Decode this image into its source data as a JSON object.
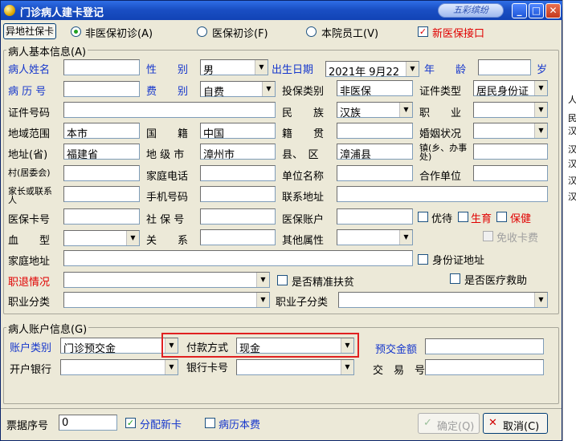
{
  "window": {
    "title": "门诊病人建卡登记",
    "badge": "五彩缤纷"
  },
  "right_strip": [
    "人",
    "民",
    "汉",
    "汉",
    "汉",
    "汉",
    "汉"
  ],
  "top": {
    "remote_card_button": "异地社保卡",
    "radio_non_insured": "非医保初诊(A)",
    "radio_insured": "医保初诊(F)",
    "radio_staff": "本院员工(V)",
    "new_insurance_interface": "新医保接口"
  },
  "basic": {
    "group_title": "病人基本信息(A)",
    "name_label": "病人姓名",
    "name_value": "",
    "gender_label": "性　　别",
    "gender_value": "男",
    "birth_label": "出生日期",
    "birth_value": "2021年 9月22",
    "age_label": "年　　龄",
    "age_value": "",
    "age_unit": "岁",
    "record_label": "病 历 号",
    "record_value": "",
    "fee_label": "费　　别",
    "fee_value": "自费",
    "insure_type_label": "投保类别",
    "insure_type_value": "非医保",
    "id_type_label": "证件类型",
    "id_type_value": "居民身份证",
    "id_no_label": "证件号码",
    "id_no_value": "",
    "nation_label": "民　　族",
    "nation_value": "汉族",
    "job_label": "职　　业",
    "job_value": "",
    "region_label": "地域范围",
    "region_value": "本市",
    "country_label": "国　　籍",
    "country_value": "中国",
    "native_label": "籍　　贯",
    "native_value": "",
    "marital_label": "婚姻状况",
    "marital_value": "",
    "province_label": "地址(省)",
    "province_value": "福建省",
    "city_label": "地 级 市",
    "city_value": "漳州市",
    "county_label": "县、　区",
    "county_value": "漳浦县",
    "town_label": "镇(乡、办事处)",
    "town_value": "",
    "village_label": "村(居委会)",
    "village_value": "",
    "home_phone_label": "家庭电话",
    "home_phone_value": "",
    "work_unit_label": "单位名称",
    "work_unit_value": "",
    "coop_unit_label": "合作单位",
    "coop_unit_value": "",
    "guardian_label": "家长或联系人",
    "guardian_value": "",
    "mobile_label": "手机号码",
    "mobile_value": "",
    "contact_addr_label": "联系地址",
    "contact_addr_value": "",
    "insurance_card_label": "医保卡号",
    "insurance_card_value": "",
    "social_no_label": "社 保 号",
    "social_no_value": "",
    "insurance_account_label": "医保账户",
    "insurance_account_value": "",
    "chk_priority": "优待",
    "chk_birth": "生育",
    "chk_care": "保健",
    "blood_label": "血　　型",
    "blood_value": "",
    "relation_label": "关　　系",
    "relation_value": "",
    "other_attr_label": "其他属性",
    "other_attr_value": "",
    "chk_free_card": "免收卡费",
    "home_addr_label": "家庭地址",
    "home_addr_value": "",
    "chk_id_addr": "身份证地址",
    "retire_label": "职退情况",
    "retire_value": "",
    "chk_poverty": "是否精准扶贫",
    "chk_medical_aid": "是否医疗救助",
    "job_class_label": "职业分类",
    "job_class_value": "",
    "job_subclass_label": "职业子分类",
    "job_subclass_value": ""
  },
  "account": {
    "group_title": "病人账户信息(G)",
    "type_label": "账户类别",
    "type_value": "门诊预交金",
    "pay_label": "付款方式",
    "pay_value": "现金",
    "prepay_label": "预交金额",
    "prepay_value": "",
    "bank_label": "开户银行",
    "bank_value": "",
    "bank_card_label": "银行卡号",
    "bank_card_value": "",
    "txn_label": "交　易　号",
    "txn_value": ""
  },
  "bottom": {
    "receipt_label": "票据序号",
    "receipt_value": "0",
    "chk_assign_card": "分配新卡",
    "chk_record_book": "病历本费",
    "ok_button": "确定(Q)",
    "cancel_button": "取消(C)"
  },
  "colors": {
    "label_blue": "#1536cc",
    "label_red": "#e00000",
    "highlight_box": "#e02020"
  }
}
